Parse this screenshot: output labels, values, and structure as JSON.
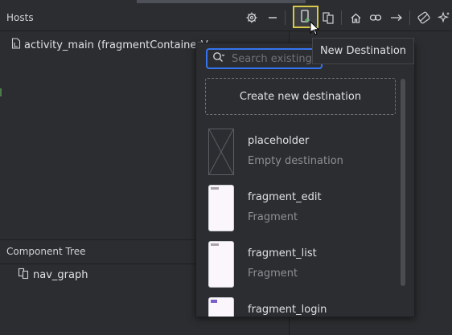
{
  "hosts_panel": {
    "title": "Hosts",
    "host_item": "activity_main (fragmentContainerV"
  },
  "component_tree": {
    "title": "Component Tree",
    "root": "nav_graph"
  },
  "toolbar": {
    "icons": [
      "gear-icon",
      "minimize-icon",
      "new-destination-icon",
      "nested-graph-icon",
      "home-icon",
      "link-icon",
      "arrow-right-icon",
      "auto-arrange-icon",
      "sparkle-icon"
    ]
  },
  "tooltip": {
    "text": "New Destination"
  },
  "popup": {
    "search_placeholder": "Search existing",
    "create_label": "Create new destination",
    "destinations": [
      {
        "name": "placeholder",
        "type": "Empty destination"
      },
      {
        "name": "fragment_edit",
        "type": "Fragment"
      },
      {
        "name": "fragment_list",
        "type": "Fragment"
      },
      {
        "name": "fragment_login",
        "type": ""
      }
    ]
  },
  "colors": {
    "accent": "#3574f0",
    "highlight": "#d9c94a",
    "background": "#2b2d30"
  }
}
